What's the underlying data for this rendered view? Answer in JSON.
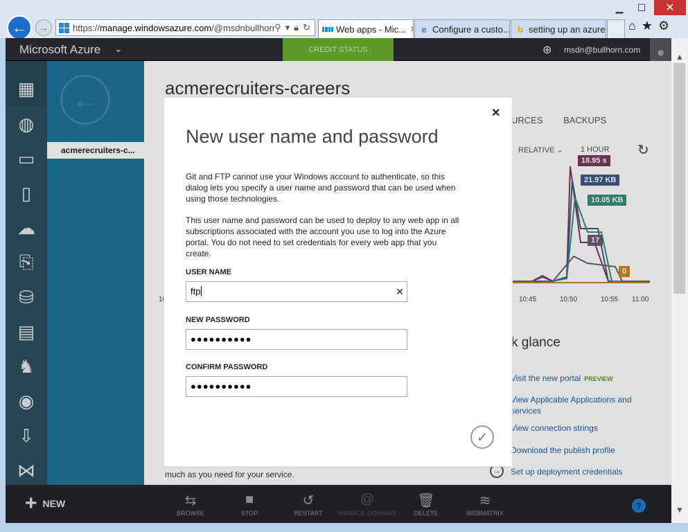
{
  "browser": {
    "window_controls": {
      "minimize": "▁",
      "maximize": "☐",
      "close": "✕"
    },
    "address": {
      "prefix": "https://",
      "host": "manage.windowsazure.com",
      "path": "/@msdnbullhorn"
    },
    "tabs": [
      {
        "label": "Web apps - Mic...",
        "active": true,
        "icon": "windows-logo-icon"
      },
      {
        "label": "Configure a custo...",
        "active": false,
        "icon": "ie-icon"
      },
      {
        "label": "setting up an azure...",
        "active": false,
        "icon": "bing-icon"
      }
    ],
    "toolbar_icons": [
      "home-icon",
      "favorites-star-icon",
      "settings-gear-icon"
    ]
  },
  "portal": {
    "brand": "Microsoft Azure",
    "credit_status": "CREDIT STATUS",
    "user_email": "msdn@bullhorn.com",
    "selected_site": "acmerecruiters-c...",
    "site_title": "acmerecruiters-careers",
    "tabs_partial": [
      "URCES",
      "BACKUPS"
    ],
    "filter_relative": "RELATIVE",
    "filter_range": "1 HOUR",
    "chart_tags": [
      "18.95 s",
      "21.97 KB",
      "10.05 KB",
      "17",
      "0"
    ],
    "time_ticks": [
      "10:45",
      "10:50",
      "10:55",
      "11:00"
    ],
    "tick_partial": "10",
    "quick_glance_title": "k glance",
    "quick_glance_links": [
      "Visit the new portal",
      "View Applicable Applications and",
      "services",
      "View connection strings",
      "Download the publish profile",
      "Set up deployment credentials"
    ],
    "preview_badge": "PREVIEW",
    "desc_text": "much as you need for your service.",
    "new_label": "NEW",
    "commands": [
      {
        "label": "BROWSE",
        "icon": "browse-icon",
        "enabled": true
      },
      {
        "label": "STOP",
        "icon": "stop-icon",
        "enabled": true
      },
      {
        "label": "RESTART",
        "icon": "restart-icon",
        "enabled": true
      },
      {
        "label": "MANAGE DOMAINS",
        "icon": "manage-domains-icon",
        "enabled": false
      },
      {
        "label": "DELETE",
        "icon": "delete-icon",
        "enabled": true
      },
      {
        "label": "WEBMATRIX",
        "icon": "webmatrix-icon",
        "enabled": true
      }
    ],
    "help": "?"
  },
  "dialog": {
    "title": "New user name and password",
    "paragraph_1": "Git and FTP cannot use your Windows account to authenticate, so this dialog lets you specify a user name and password that can be used when using those technologies.",
    "paragraph_2": "This user name and password can be used to deploy to any web app in all subscriptions associated with the account you use to log into the Azure portal. You do not need to set credentials for every web app that you create.",
    "user_name_label": "USER NAME",
    "user_name_value": "ftp",
    "new_password_label": "NEW PASSWORD",
    "new_password_value": "●●●●●●●●●●",
    "confirm_password_label": "CONFIRM PASSWORD",
    "confirm_password_value": "●●●●●●●●●●"
  },
  "colors": {
    "azure_nav": "#2f4f5f",
    "azure_subnav": "#1f7499",
    "credit_green": "#5c9a2a",
    "link_blue": "#1e5fa8"
  }
}
